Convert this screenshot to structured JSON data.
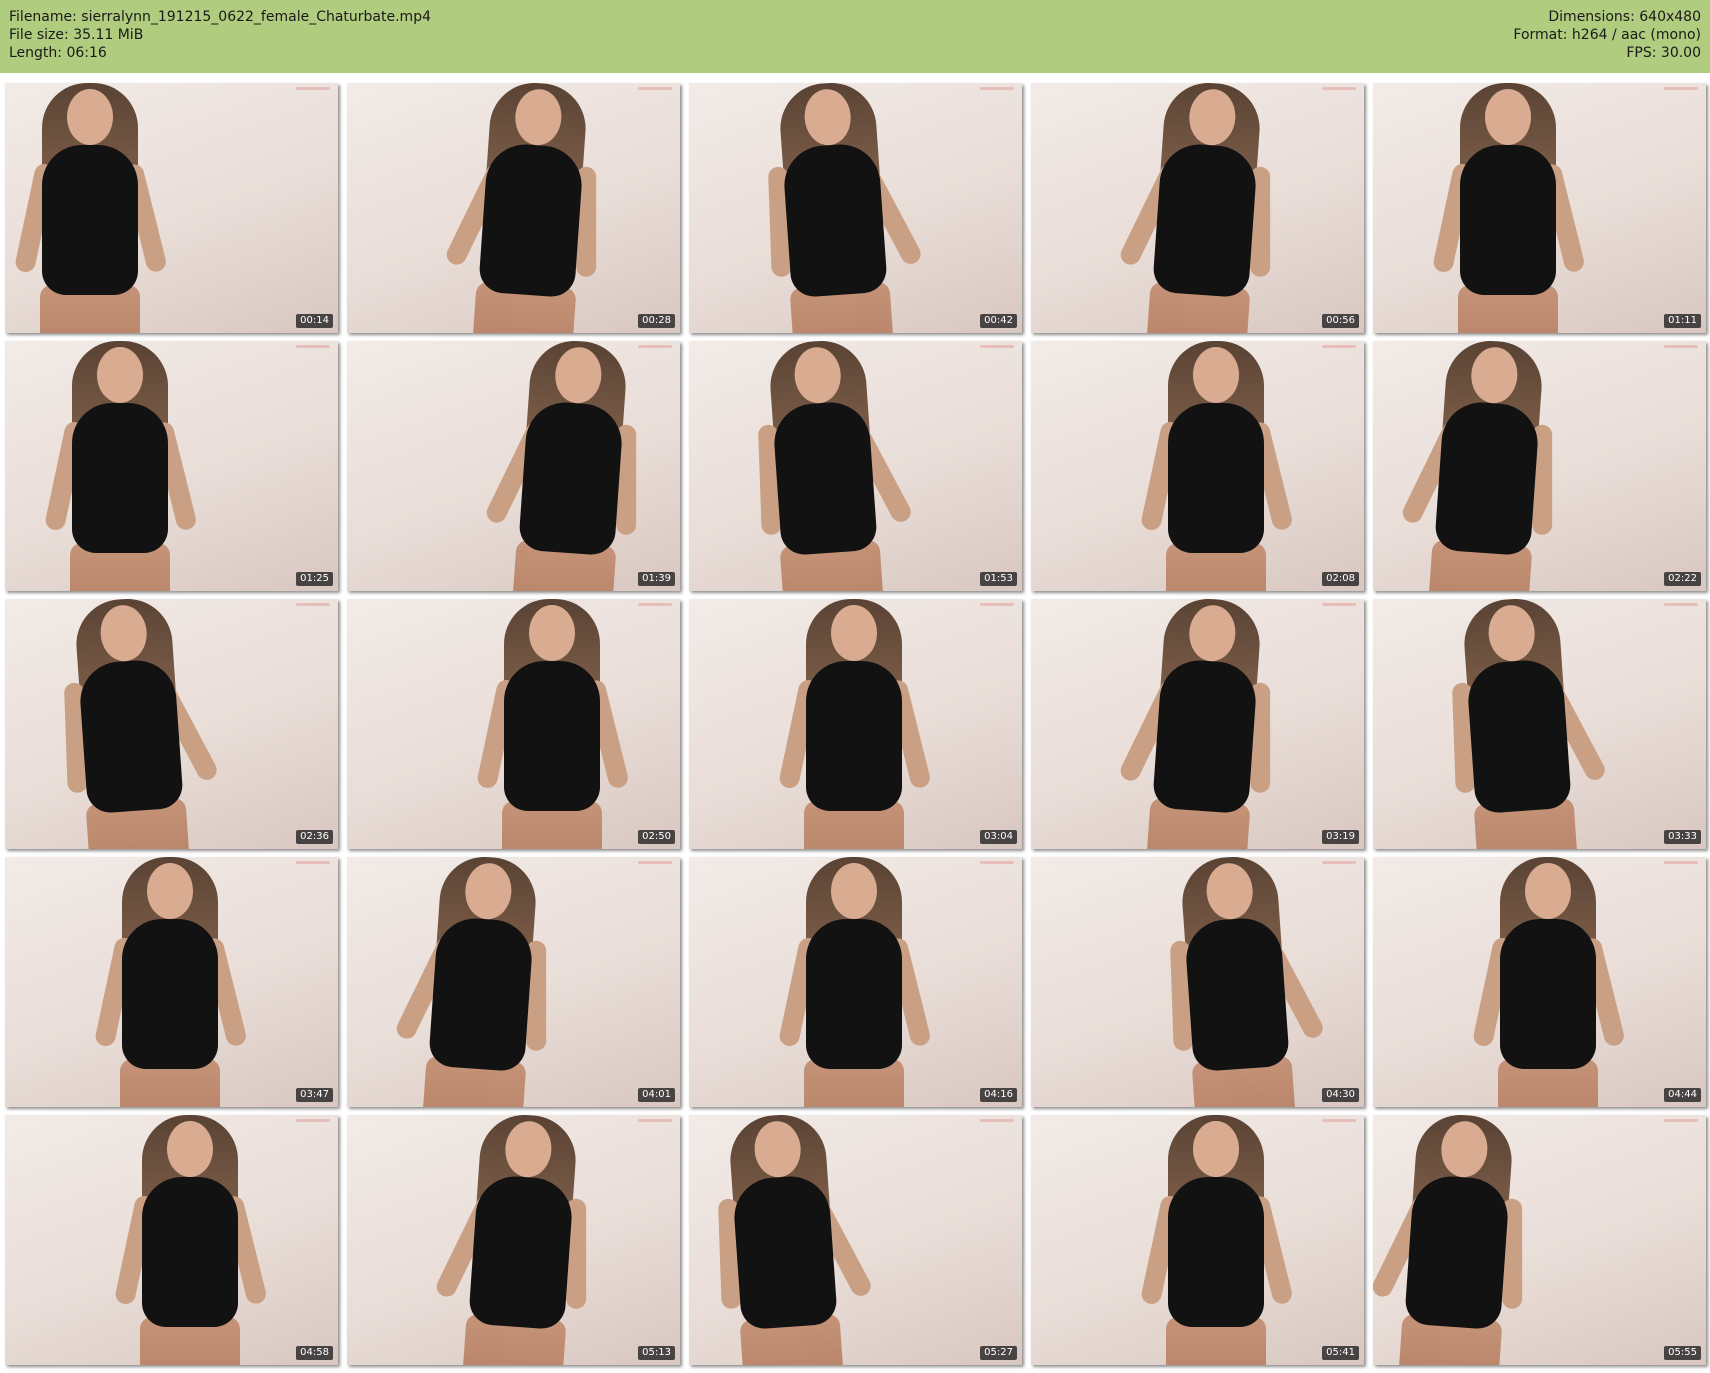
{
  "header": {
    "filename_line": "Filename: sierralynn_191215_0622_female_Chaturbate.mp4",
    "filesize_line": "File size: 35.11 MiB",
    "length_line": "Length: 06:16",
    "dimensions_line": "Dimensions: 640x480",
    "format_line": "Format: h264 / aac (mono)",
    "fps_line": "FPS: 30.00",
    "background_color": "#b0cc7f"
  },
  "thumbnails": [
    {
      "timestamp": "00:14"
    },
    {
      "timestamp": "00:28"
    },
    {
      "timestamp": "00:42"
    },
    {
      "timestamp": "00:56"
    },
    {
      "timestamp": "01:11"
    },
    {
      "timestamp": "01:25"
    },
    {
      "timestamp": "01:39"
    },
    {
      "timestamp": "01:53"
    },
    {
      "timestamp": "02:08"
    },
    {
      "timestamp": "02:22"
    },
    {
      "timestamp": "02:36"
    },
    {
      "timestamp": "02:50"
    },
    {
      "timestamp": "03:04"
    },
    {
      "timestamp": "03:19"
    },
    {
      "timestamp": "03:33"
    },
    {
      "timestamp": "03:47"
    },
    {
      "timestamp": "04:01"
    },
    {
      "timestamp": "04:16"
    },
    {
      "timestamp": "04:30"
    },
    {
      "timestamp": "04:44"
    },
    {
      "timestamp": "04:58"
    },
    {
      "timestamp": "05:13"
    },
    {
      "timestamp": "05:27"
    },
    {
      "timestamp": "05:41"
    },
    {
      "timestamp": "05:55"
    }
  ]
}
